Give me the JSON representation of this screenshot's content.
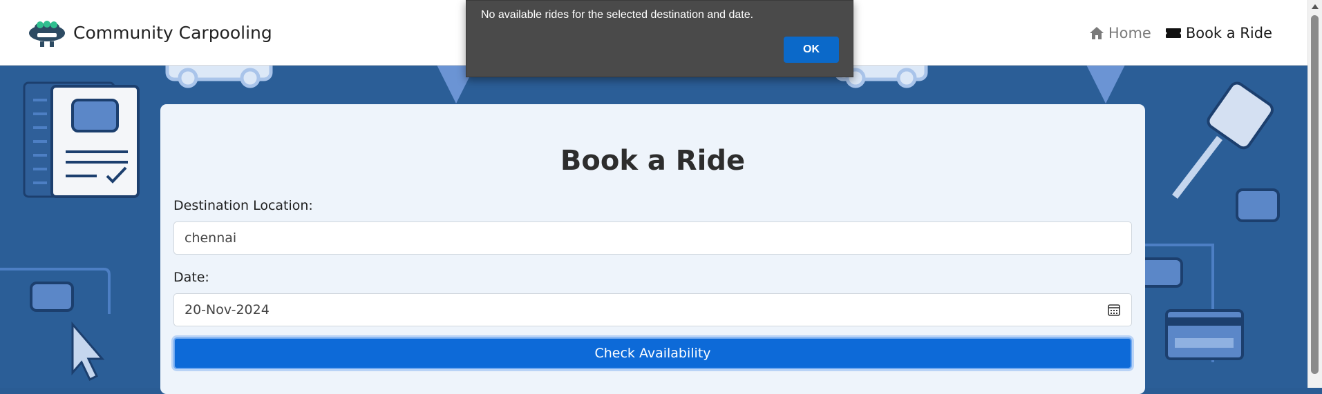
{
  "navbar": {
    "brand": "Community Carpooling",
    "links": [
      {
        "label": "Home",
        "icon": "home-icon"
      },
      {
        "label": "Book a Ride",
        "icon": "ticket-icon"
      }
    ]
  },
  "card": {
    "title": "Book a Ride",
    "destination_label": "Destination Location:",
    "destination_value": "chennai",
    "date_label": "Date:",
    "date_value": "20-Nov-2024",
    "button_label": "Check Availability"
  },
  "dialog": {
    "message": "No available rides for the selected destination and date.",
    "ok_label": "OK"
  },
  "colors": {
    "background": "#2b5e97",
    "accent": "#0d6ad8",
    "dialog_bg": "#4a4a4a"
  }
}
